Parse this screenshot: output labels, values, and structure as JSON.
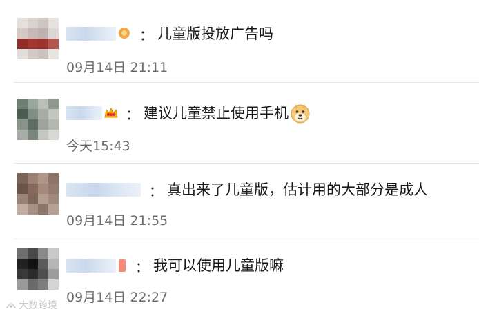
{
  "comments": [
    {
      "separator": "：",
      "text": "儿童版投放广告吗",
      "time": "09月14日 21:11",
      "badge_icon": "vip-badge-icon",
      "avatar_colors": [
        "#e8dfdc",
        "#d9d3d0",
        "#cfc6c2",
        "#e6e2e0",
        "#d6c9c5",
        "#c9b9b4",
        "#bfb1ad",
        "#ddd6d3",
        "#8f2d2a",
        "#a23531",
        "#9a3230",
        "#b3564f",
        "#e4dedb",
        "#d2c9c6",
        "#cbc2bf",
        "#e8e4e2"
      ]
    },
    {
      "separator": "：",
      "text": "建议儿童禁止使用手机",
      "time": "今天15:43",
      "badge_icon": "crown-icon",
      "emoji_icon": "doge-emoji-icon",
      "avatar_colors": [
        "#6f7e73",
        "#9aa79c",
        "#b9c0b7",
        "#8e9a8f",
        "#4d5c52",
        "#7f8d82",
        "#a6ada3",
        "#c2c7bf",
        "#8a948a",
        "#5f6e64",
        "#9fa59d",
        "#b3b8b0",
        "#a8aea7",
        "#7b877d",
        "#c5c8c2",
        "#d6d8d3"
      ]
    },
    {
      "separator": "：",
      "text": "真出来了儿童版，估计用的大部分是成人",
      "time": "09月14日 21:55",
      "avatar_colors": [
        "#7a6458",
        "#9b8173",
        "#b09688",
        "#8d7669",
        "#6b5448",
        "#86695b",
        "#a7897a",
        "#937b6e",
        "#9a8375",
        "#7e6659",
        "#b49d90",
        "#a08a7d",
        "#c2ada2",
        "#a69184",
        "#8b7569",
        "#b5a296"
      ]
    },
    {
      "separator": "：",
      "text": "我可以使用儿童版嘛",
      "time": "09月14日 22:27",
      "badge_icon": "member-badge-icon",
      "avatar_colors": [
        "#6e6e6e",
        "#4a4a4a",
        "#8a8a8a",
        "#c9c9c9",
        "#202020",
        "#111111",
        "#5b5b5b",
        "#b6b6b6",
        "#3a3a3a",
        "#2b2b2b",
        "#4f4f4f",
        "#9c9c9c",
        "#9a9a9a",
        "#6a6a6a",
        "#7d7d7d",
        "#d4d4d4"
      ]
    }
  ],
  "watermark": "大数跨境"
}
